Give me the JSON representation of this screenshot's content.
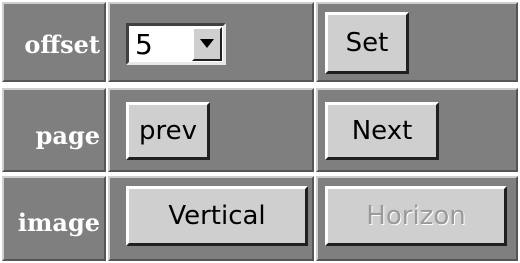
{
  "rows": [
    {
      "label": "offset"
    },
    {
      "label": "page"
    },
    {
      "label": "image"
    }
  ],
  "offset": {
    "select_value": "5",
    "set_label": "Set"
  },
  "page": {
    "prev_label": "prev",
    "next_label": "Next"
  },
  "image": {
    "vertical_label": "Vertical",
    "horizon_label": "Horizon",
    "horizon_enabled": false
  },
  "colors": {
    "cell_background": "#7f7f7f",
    "button_face": "#cfcfcf",
    "label_text": "#ffffff",
    "disabled_text": "#9a9a9a"
  },
  "icons": {
    "dropdown": "chevron-down-icon"
  }
}
